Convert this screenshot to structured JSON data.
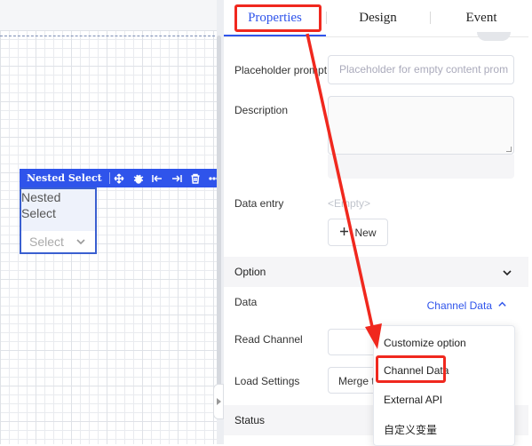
{
  "canvas": {
    "component_title": "Nested Select",
    "nested_label": "Nested Select",
    "select_placeholder": "Select"
  },
  "tabs": [
    {
      "label": "Properties",
      "active": true
    },
    {
      "label": "Design",
      "active": false
    },
    {
      "label": "Event",
      "active": false
    }
  ],
  "form": {
    "placeholder_prompt": {
      "label": "Placeholder prompt",
      "placeholder": "Placeholder for empty content prompt"
    },
    "description": {
      "label": "Description"
    },
    "data_entry": {
      "label": "Data entry",
      "empty_text": "<Empty>",
      "new_button": "New"
    },
    "option_section": "Option",
    "data": {
      "label": "Data",
      "value": "Channel Data"
    },
    "read_channel": {
      "label": "Read Channel"
    },
    "load_settings": {
      "label": "Load Settings",
      "value": "Merge t"
    },
    "status_section": "Status"
  },
  "dropdown": {
    "items": [
      "Customize option",
      "Channel Data",
      "External API",
      "自定义变量"
    ],
    "highlighted": "Channel Data"
  },
  "colors": {
    "accent": "#2f54eb",
    "highlight": "#f0281e"
  }
}
